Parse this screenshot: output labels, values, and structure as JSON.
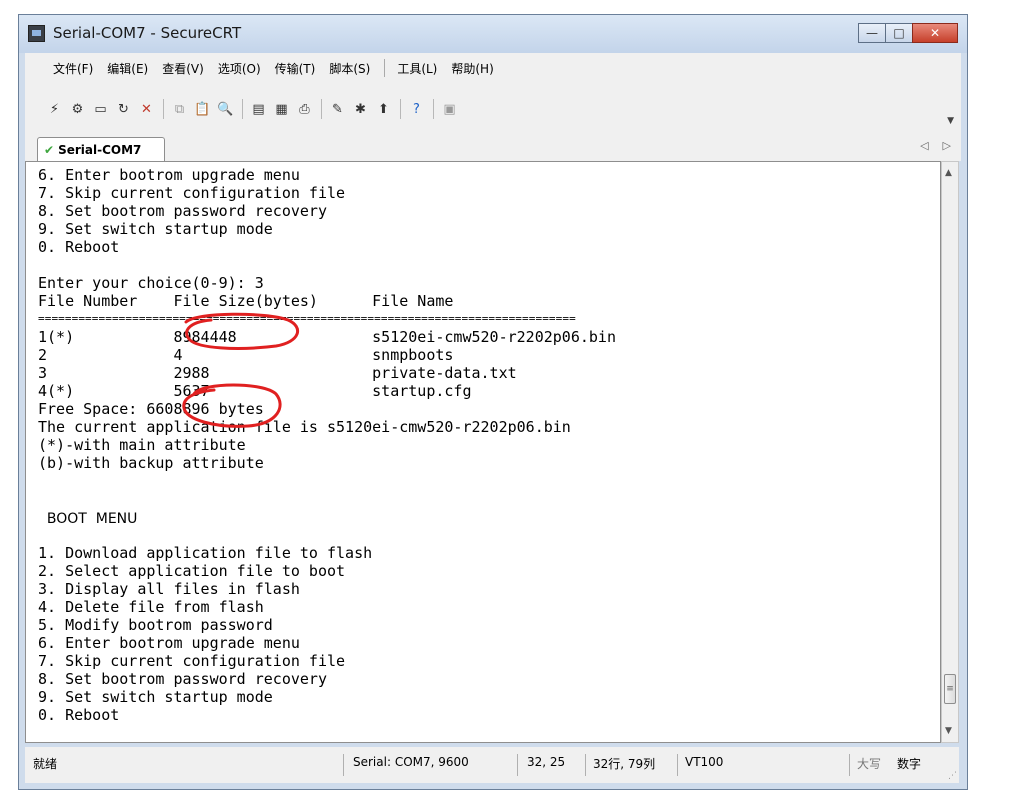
{
  "window": {
    "title": "Serial-COM7 - SecureCRT",
    "minimize_label": "—",
    "maximize_label": "□",
    "close_label": "✕"
  },
  "menubar": {
    "items": [
      "文件(F)",
      "编辑(E)",
      "查看(V)",
      "选项(O)",
      "传输(T)",
      "脚本(S)",
      "工具(L)",
      "帮助(H)"
    ]
  },
  "toolbar": {
    "icons": [
      "connect-icon",
      "quick-connect-icon",
      "connect-tab-icon",
      "reconnect-icon",
      "disconnect-icon",
      "copy-icon",
      "paste-icon",
      "find-icon",
      "print-setup-icon",
      "print-icon",
      "printer-icon",
      "session-options-icon",
      "keymap-icon",
      "sftp-icon",
      "help-icon",
      "send-file-icon"
    ]
  },
  "tabs": [
    {
      "label": "Serial-COM7",
      "active": true
    }
  ],
  "terminal": {
    "lines": [
      "6. Enter bootrom upgrade menu",
      "7. Skip current configuration file",
      "8. Set bootrom password recovery",
      "9. Set switch startup mode",
      "0. Reboot",
      "",
      "Enter your choice(0-9): 3",
      "File Number    File Size(bytes)      File Name",
      "================================================================================",
      "1(*)           8984448               s5120ei-cmw520-r2202p06.bin",
      "2              4                     snmpboots",
      "3              2988                  private-data.txt",
      "4(*)           5637                  startup.cfg",
      "Free Space: 6608896 bytes",
      "The current application file is s5120ei-cmw520-r2202p06.bin",
      "(*)-with main attribute",
      "(b)-with backup attribute",
      "",
      "",
      "  BOOT  MENU",
      "",
      "1. Download application file to flash",
      "2. Select application file to boot",
      "3. Display all files in flash",
      "4. Delete file from flash",
      "5. Modify bootrom password",
      "6. Enter bootrom upgrade menu",
      "7. Skip current configuration file",
      "8. Set bootrom password recovery",
      "9. Set switch startup mode",
      "0. Reboot"
    ],
    "annotation_color": "#e02020"
  },
  "statusbar": {
    "state": "就绪",
    "connection": "Serial: COM7, 9600",
    "cursor": "32,  25",
    "size": "32行, 79列",
    "emulation": "VT100",
    "caps": "大写",
    "num": "数字"
  }
}
